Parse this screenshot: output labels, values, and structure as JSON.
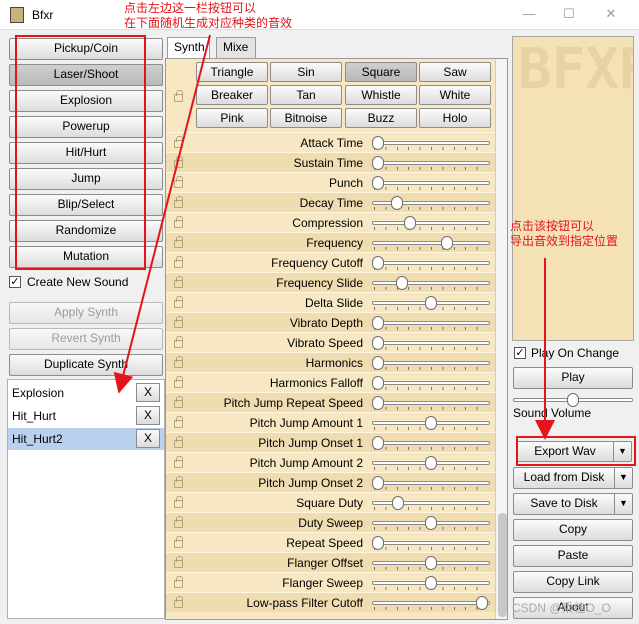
{
  "window": {
    "title": "Bfxr",
    "minimize": "—",
    "maximize": "☐",
    "close": "✕"
  },
  "generators": [
    "Pickup/Coin",
    "Laser/Shoot",
    "Explosion",
    "Powerup",
    "Hit/Hurt",
    "Jump",
    "Blip/Select",
    "Randomize",
    "Mutation"
  ],
  "create_new_sound": {
    "label": "Create New Sound",
    "checked": true
  },
  "left_actions": {
    "apply": "Apply Synth",
    "revert": "Revert Synth",
    "duplicate": "Duplicate Synth"
  },
  "sounds": [
    {
      "name": "Explosion",
      "x": "X"
    },
    {
      "name": "Hit_Hurt",
      "x": "X"
    },
    {
      "name": "Hit_Hurt2",
      "x": "X"
    }
  ],
  "tabs": [
    "Synth",
    "Mixe"
  ],
  "waveforms": [
    {
      "label": "Triangle",
      "selected": false
    },
    {
      "label": "Sin",
      "selected": false
    },
    {
      "label": "Square",
      "selected": true
    },
    {
      "label": "Saw",
      "selected": false
    },
    {
      "label": "Breaker",
      "selected": false
    },
    {
      "label": "Tan",
      "selected": false
    },
    {
      "label": "Whistle",
      "selected": false
    },
    {
      "label": "White",
      "selected": false
    },
    {
      "label": "Pink",
      "selected": false
    },
    {
      "label": "Bitnoise",
      "selected": false
    },
    {
      "label": "Buzz",
      "selected": false
    },
    {
      "label": "Holo",
      "selected": false
    }
  ],
  "params": [
    {
      "label": "Attack Time",
      "value": 0.0
    },
    {
      "label": "Sustain Time",
      "value": 0.0
    },
    {
      "label": "Punch",
      "value": 0.0
    },
    {
      "label": "Decay Time",
      "value": 0.18
    },
    {
      "label": "Compression",
      "value": 0.3
    },
    {
      "label": "Frequency",
      "value": 0.65
    },
    {
      "label": "Frequency Cutoff",
      "value": 0.0
    },
    {
      "label": "Frequency Slide",
      "value": 0.23
    },
    {
      "label": "Delta Slide",
      "value": 0.5
    },
    {
      "label": "Vibrato Depth",
      "value": 0.0
    },
    {
      "label": "Vibrato Speed",
      "value": 0.0
    },
    {
      "label": "Harmonics",
      "value": 0.0
    },
    {
      "label": "Harmonics Falloff",
      "value": 0.0
    },
    {
      "label": "Pitch Jump Repeat Speed",
      "value": 0.0
    },
    {
      "label": "Pitch Jump Amount 1",
      "value": 0.5
    },
    {
      "label": "Pitch Jump Onset 1",
      "value": 0.0
    },
    {
      "label": "Pitch Jump Amount 2",
      "value": 0.5
    },
    {
      "label": "Pitch Jump Onset 2",
      "value": 0.0
    },
    {
      "label": "Square Duty",
      "value": 0.19
    },
    {
      "label": "Duty Sweep",
      "value": 0.5
    },
    {
      "label": "Repeat Speed",
      "value": 0.0
    },
    {
      "label": "Flanger Offset",
      "value": 0.5
    },
    {
      "label": "Flanger Sweep",
      "value": 0.5
    },
    {
      "label": "Low-pass Filter Cutoff",
      "value": 0.98
    }
  ],
  "right": {
    "logo": "BFXR",
    "play_on_change": {
      "label": "Play On Change",
      "checked": true
    },
    "play": "Play",
    "volume_label": "Sound Volume",
    "volume": 0.5,
    "export": "Export Wav",
    "load": "Load from Disk",
    "save": "Save to Disk",
    "copy": "Copy",
    "paste": "Paste",
    "copy_link": "Copy Link",
    "about": "About"
  },
  "annotations": {
    "left_line1": "点击左边这一栏按钮可以",
    "left_line2": "在下面随机生成对应种类的音效",
    "right_line1": "点击该按钮可以",
    "right_line2": "导出音效到指定位置"
  },
  "watermark": "CSDN @乘桂O_O",
  "colors": {
    "panel": "#f7e7c2",
    "panel_alt": "#efdcb0",
    "selected_row": "#b9d1ee",
    "annotation": "#e3141b"
  }
}
